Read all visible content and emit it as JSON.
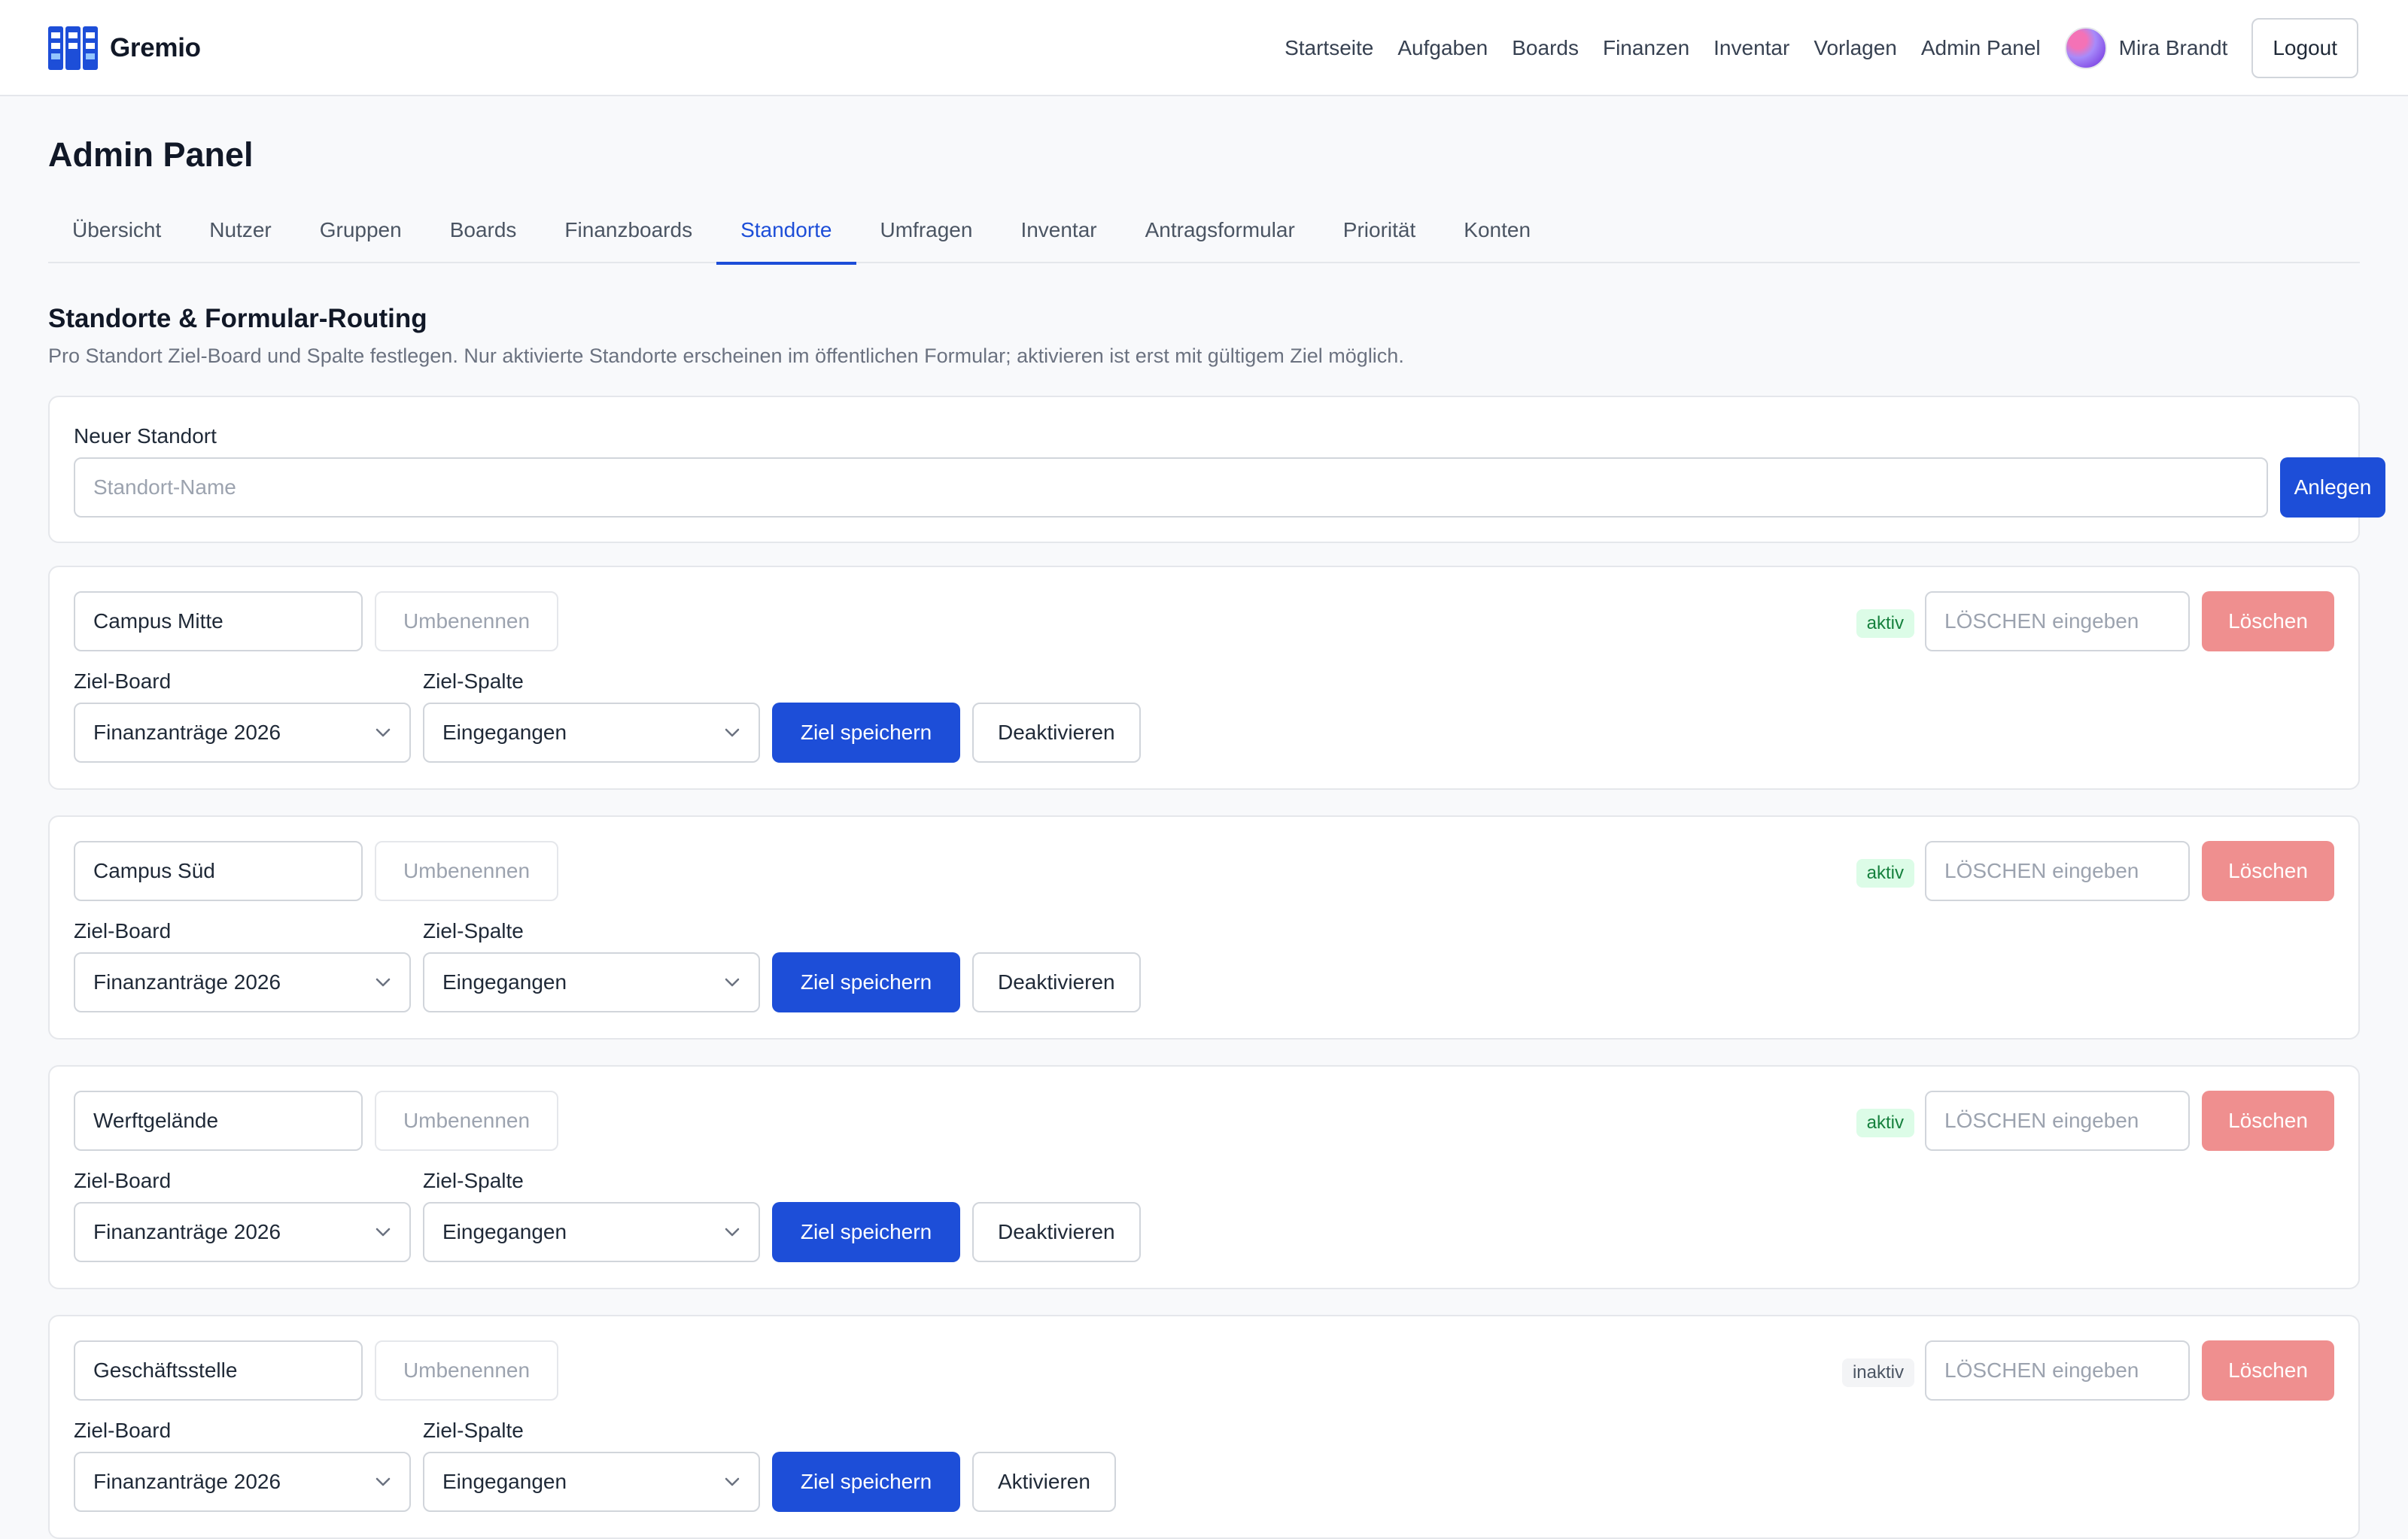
{
  "brand": {
    "name": "Gremio",
    "logo_icon": "kanban-logo-icon",
    "color": "#1d4ed8"
  },
  "nav": {
    "links": [
      "Startseite",
      "Aufgaben",
      "Boards",
      "Finanzen",
      "Inventar",
      "Vorlagen",
      "Admin Panel"
    ],
    "user_name": "Mira Brandt",
    "logout_label": "Logout"
  },
  "page": {
    "title": "Admin Panel",
    "tabs": [
      "Übersicht",
      "Nutzer",
      "Gruppen",
      "Boards",
      "Finanzboards",
      "Standorte",
      "Umfragen",
      "Inventar",
      "Antragsformular",
      "Priorität",
      "Konten"
    ],
    "active_tab": "Standorte"
  },
  "section": {
    "title": "Standorte & Formular-Routing",
    "description": "Pro Standort Ziel-Board und Spalte festlegen. Nur aktivierte Standorte erscheinen im öffentlichen Formular; aktivieren ist erst mit gültigem Ziel möglich."
  },
  "new_location": {
    "label": "Neuer Standort",
    "placeholder": "Standort-Name",
    "value": "",
    "create_label": "Anlegen"
  },
  "labels": {
    "rename": "Umbenennen",
    "target_board": "Ziel-Board",
    "target_column": "Ziel-Spalte",
    "save_target": "Ziel speichern",
    "delete": "Löschen",
    "delete_confirm_placeholder": "LÖSCHEN eingeben"
  },
  "locations": [
    {
      "name": "Campus Mitte",
      "status": "aktiv",
      "board": "Finanzanträge 2026",
      "column": "Eingegangen",
      "toggle_label": "Deaktivieren"
    },
    {
      "name": "Campus Süd",
      "status": "aktiv",
      "board": "Finanzanträge 2026",
      "column": "Eingegangen",
      "toggle_label": "Deaktivieren"
    },
    {
      "name": "Werftgelände",
      "status": "aktiv",
      "board": "Finanzanträge 2026",
      "column": "Eingegangen",
      "toggle_label": "Deaktivieren"
    },
    {
      "name": "Geschäftsstelle",
      "status": "inaktiv",
      "board": "Finanzanträge 2026",
      "column": "Eingegangen",
      "toggle_label": "Aktivieren"
    }
  ],
  "colors": {
    "primary": "#1d4ed8",
    "danger_disabled": "#ef8f8f",
    "badge_active_bg": "#dcfce7",
    "badge_active_text": "#15803d",
    "badge_inactive_bg": "#f3f4f6"
  }
}
